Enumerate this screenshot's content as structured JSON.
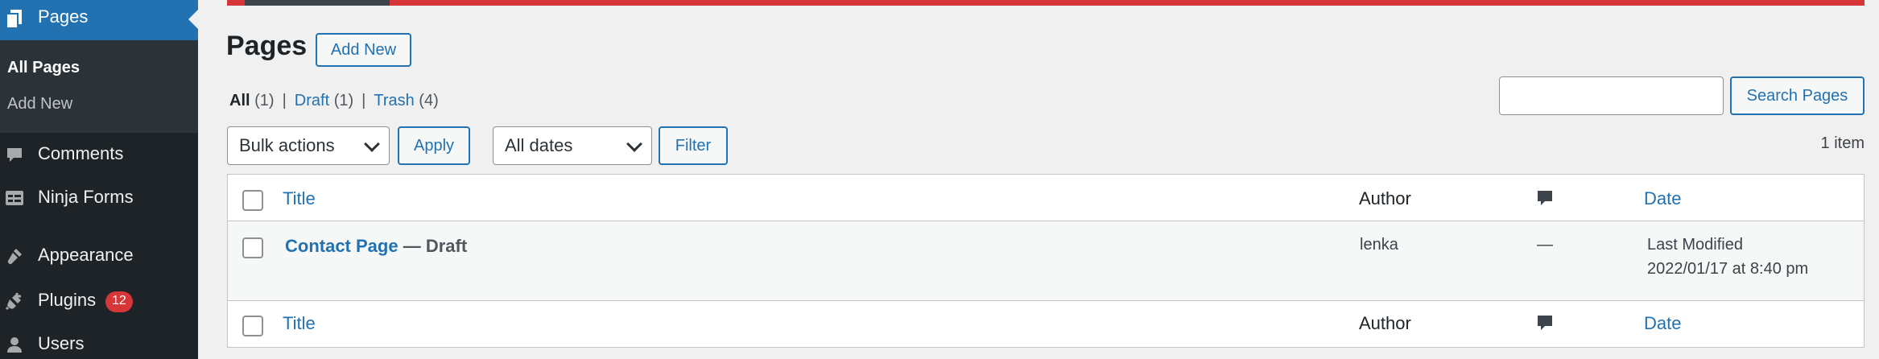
{
  "sidebar": {
    "current": {
      "label": "Pages",
      "icon": "pages-icon"
    },
    "submenu": [
      {
        "label": "All Pages",
        "current": true
      },
      {
        "label": "Add New",
        "current": false
      }
    ],
    "items": [
      {
        "label": "Comments",
        "icon": "comments-icon"
      },
      {
        "label": "Ninja Forms",
        "icon": "ninja-forms-icon"
      },
      {
        "label": "Appearance",
        "icon": "appearance-icon"
      },
      {
        "label": "Plugins",
        "icon": "plugins-icon",
        "badge": "12"
      },
      {
        "label": "Users",
        "icon": "users-icon"
      }
    ]
  },
  "header": {
    "title": "Pages",
    "add_new_label": "Add New"
  },
  "filters": {
    "all": {
      "label": "All",
      "count": "(1)"
    },
    "draft": {
      "label": "Draft",
      "count": "(1)"
    },
    "trash": {
      "label": "Trash",
      "count": "(4)"
    },
    "separator": "|"
  },
  "search": {
    "value": "",
    "button_label": "Search Pages"
  },
  "toolbar": {
    "bulk_actions": "Bulk actions",
    "apply_label": "Apply",
    "dates": "All dates",
    "filter_label": "Filter",
    "items_count": "1 item"
  },
  "table": {
    "columns": {
      "title": "Title",
      "author": "Author",
      "comments_icon": "comment-bubble-icon",
      "date": "Date"
    },
    "rows": [
      {
        "title": "Contact Page",
        "state": "— Draft",
        "author": "lenka",
        "comments": "—",
        "date_status": "Last Modified",
        "date_value": "2022/01/17 at 8:40 pm"
      }
    ]
  },
  "colors": {
    "sidebar_bg": "#1d2327",
    "accent": "#2271b1",
    "notice": "#d63638",
    "badge": "#d63638"
  }
}
